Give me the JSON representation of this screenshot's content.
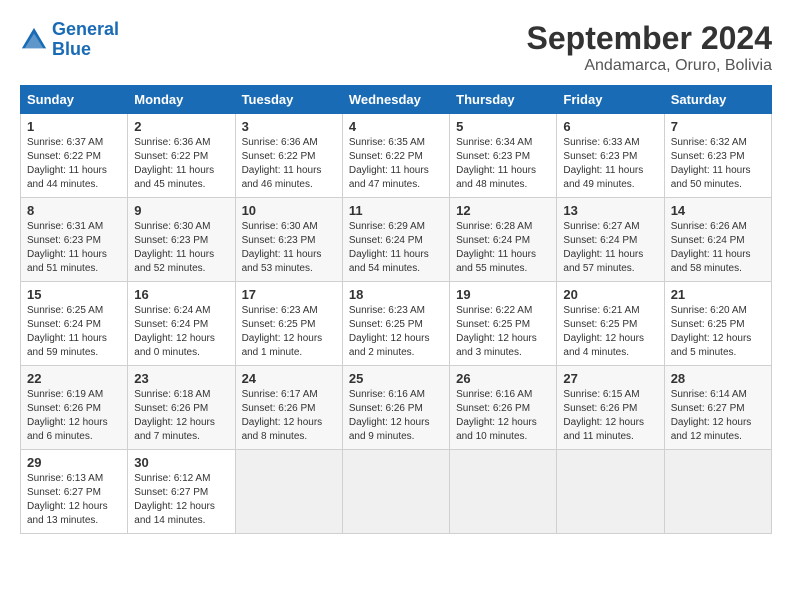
{
  "header": {
    "logo_line1": "General",
    "logo_line2": "Blue",
    "month": "September 2024",
    "location": "Andamarca, Oruro, Bolivia"
  },
  "weekdays": [
    "Sunday",
    "Monday",
    "Tuesday",
    "Wednesday",
    "Thursday",
    "Friday",
    "Saturday"
  ],
  "weeks": [
    [
      {
        "day": "1",
        "info": "Sunrise: 6:37 AM\nSunset: 6:22 PM\nDaylight: 11 hours\nand 44 minutes."
      },
      {
        "day": "2",
        "info": "Sunrise: 6:36 AM\nSunset: 6:22 PM\nDaylight: 11 hours\nand 45 minutes."
      },
      {
        "day": "3",
        "info": "Sunrise: 6:36 AM\nSunset: 6:22 PM\nDaylight: 11 hours\nand 46 minutes."
      },
      {
        "day": "4",
        "info": "Sunrise: 6:35 AM\nSunset: 6:22 PM\nDaylight: 11 hours\nand 47 minutes."
      },
      {
        "day": "5",
        "info": "Sunrise: 6:34 AM\nSunset: 6:23 PM\nDaylight: 11 hours\nand 48 minutes."
      },
      {
        "day": "6",
        "info": "Sunrise: 6:33 AM\nSunset: 6:23 PM\nDaylight: 11 hours\nand 49 minutes."
      },
      {
        "day": "7",
        "info": "Sunrise: 6:32 AM\nSunset: 6:23 PM\nDaylight: 11 hours\nand 50 minutes."
      }
    ],
    [
      {
        "day": "8",
        "info": "Sunrise: 6:31 AM\nSunset: 6:23 PM\nDaylight: 11 hours\nand 51 minutes."
      },
      {
        "day": "9",
        "info": "Sunrise: 6:30 AM\nSunset: 6:23 PM\nDaylight: 11 hours\nand 52 minutes."
      },
      {
        "day": "10",
        "info": "Sunrise: 6:30 AM\nSunset: 6:23 PM\nDaylight: 11 hours\nand 53 minutes."
      },
      {
        "day": "11",
        "info": "Sunrise: 6:29 AM\nSunset: 6:24 PM\nDaylight: 11 hours\nand 54 minutes."
      },
      {
        "day": "12",
        "info": "Sunrise: 6:28 AM\nSunset: 6:24 PM\nDaylight: 11 hours\nand 55 minutes."
      },
      {
        "day": "13",
        "info": "Sunrise: 6:27 AM\nSunset: 6:24 PM\nDaylight: 11 hours\nand 57 minutes."
      },
      {
        "day": "14",
        "info": "Sunrise: 6:26 AM\nSunset: 6:24 PM\nDaylight: 11 hours\nand 58 minutes."
      }
    ],
    [
      {
        "day": "15",
        "info": "Sunrise: 6:25 AM\nSunset: 6:24 PM\nDaylight: 11 hours\nand 59 minutes."
      },
      {
        "day": "16",
        "info": "Sunrise: 6:24 AM\nSunset: 6:24 PM\nDaylight: 12 hours\nand 0 minutes."
      },
      {
        "day": "17",
        "info": "Sunrise: 6:23 AM\nSunset: 6:25 PM\nDaylight: 12 hours\nand 1 minute."
      },
      {
        "day": "18",
        "info": "Sunrise: 6:23 AM\nSunset: 6:25 PM\nDaylight: 12 hours\nand 2 minutes."
      },
      {
        "day": "19",
        "info": "Sunrise: 6:22 AM\nSunset: 6:25 PM\nDaylight: 12 hours\nand 3 minutes."
      },
      {
        "day": "20",
        "info": "Sunrise: 6:21 AM\nSunset: 6:25 PM\nDaylight: 12 hours\nand 4 minutes."
      },
      {
        "day": "21",
        "info": "Sunrise: 6:20 AM\nSunset: 6:25 PM\nDaylight: 12 hours\nand 5 minutes."
      }
    ],
    [
      {
        "day": "22",
        "info": "Sunrise: 6:19 AM\nSunset: 6:26 PM\nDaylight: 12 hours\nand 6 minutes."
      },
      {
        "day": "23",
        "info": "Sunrise: 6:18 AM\nSunset: 6:26 PM\nDaylight: 12 hours\nand 7 minutes."
      },
      {
        "day": "24",
        "info": "Sunrise: 6:17 AM\nSunset: 6:26 PM\nDaylight: 12 hours\nand 8 minutes."
      },
      {
        "day": "25",
        "info": "Sunrise: 6:16 AM\nSunset: 6:26 PM\nDaylight: 12 hours\nand 9 minutes."
      },
      {
        "day": "26",
        "info": "Sunrise: 6:16 AM\nSunset: 6:26 PM\nDaylight: 12 hours\nand 10 minutes."
      },
      {
        "day": "27",
        "info": "Sunrise: 6:15 AM\nSunset: 6:26 PM\nDaylight: 12 hours\nand 11 minutes."
      },
      {
        "day": "28",
        "info": "Sunrise: 6:14 AM\nSunset: 6:27 PM\nDaylight: 12 hours\nand 12 minutes."
      }
    ],
    [
      {
        "day": "29",
        "info": "Sunrise: 6:13 AM\nSunset: 6:27 PM\nDaylight: 12 hours\nand 13 minutes."
      },
      {
        "day": "30",
        "info": "Sunrise: 6:12 AM\nSunset: 6:27 PM\nDaylight: 12 hours\nand 14 minutes."
      },
      {
        "day": "",
        "info": ""
      },
      {
        "day": "",
        "info": ""
      },
      {
        "day": "",
        "info": ""
      },
      {
        "day": "",
        "info": ""
      },
      {
        "day": "",
        "info": ""
      }
    ]
  ]
}
